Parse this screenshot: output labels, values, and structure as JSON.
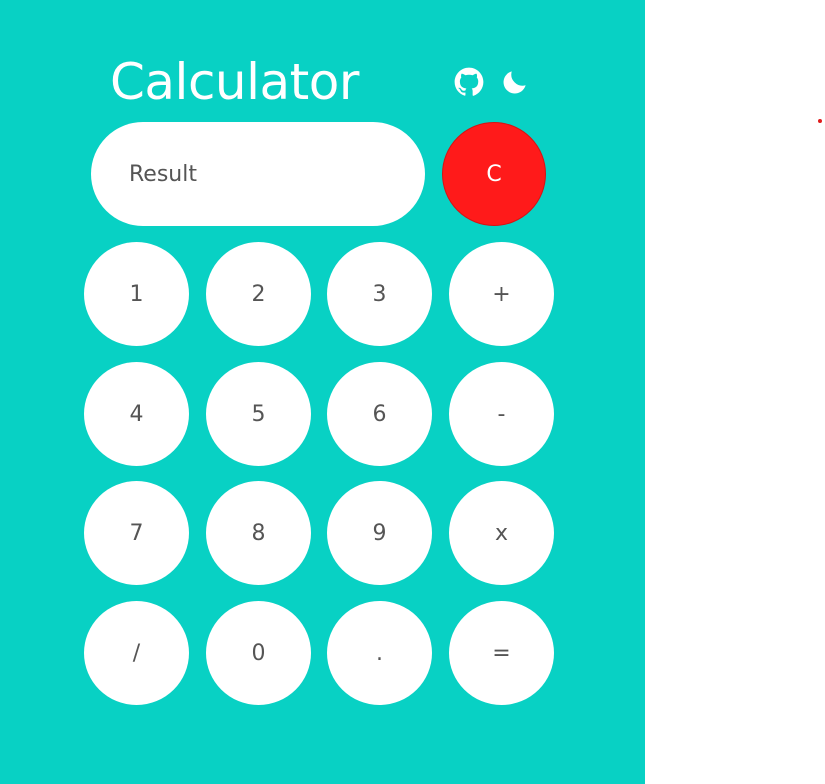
{
  "app": {
    "title": "Calculator",
    "background_color": "#08d1c4",
    "icons": [
      {
        "name": "github-icon"
      },
      {
        "name": "moon-icon"
      }
    ]
  },
  "display": {
    "placeholder": "Result",
    "value": ""
  },
  "clear_button": {
    "label": "C",
    "color": "#ff1a1a"
  },
  "keypad": [
    [
      "1",
      "2",
      "3",
      "+"
    ],
    [
      "4",
      "5",
      "6",
      "-"
    ],
    [
      "7",
      "8",
      "9",
      "x"
    ],
    [
      "/",
      "0",
      ".",
      "="
    ]
  ],
  "accent_dot_color": "#e01c1c"
}
